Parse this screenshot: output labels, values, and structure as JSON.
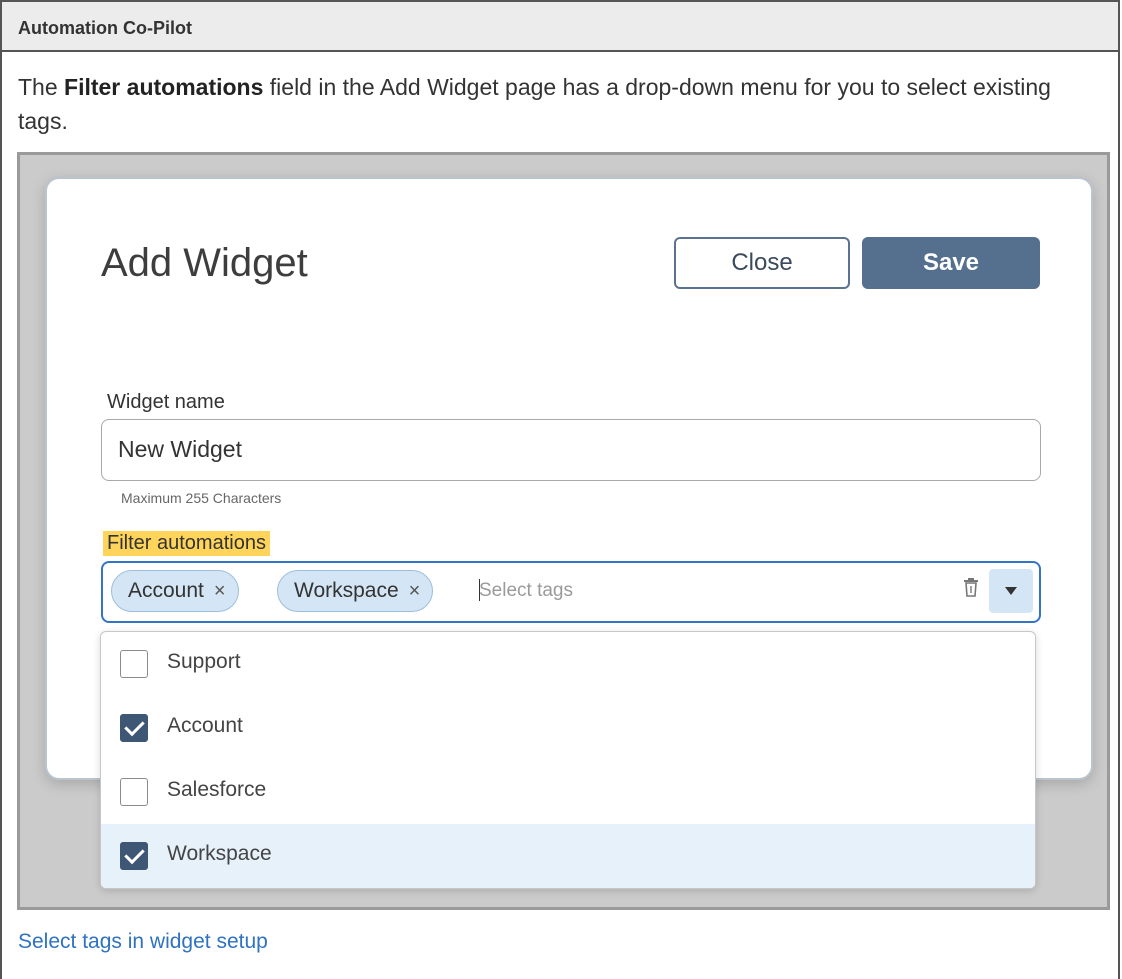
{
  "doc": {
    "header": "Automation Co-Pilot",
    "intro_before": "The ",
    "intro_bold": "Filter automations",
    "intro_after": " field in the Add Widget page has a drop-down menu for you to select existing tags.",
    "caption": "Select tags in widget setup"
  },
  "modal": {
    "title": "Add Widget",
    "close_label": "Close",
    "save_label": "Save",
    "widget_name_label": "Widget name",
    "widget_name_value": "New Widget",
    "widget_name_hint": "Maximum 255 Characters",
    "filter_label": "Filter automations",
    "selected_tags": [
      {
        "label": "Account",
        "remove": "×"
      },
      {
        "label": "Workspace",
        "remove": "×"
      }
    ],
    "tags_placeholder": "Select tags",
    "clear_icon": "trash-icon",
    "dropdown_icon": "caret-down-icon"
  },
  "menu": {
    "options": [
      {
        "label": "Support",
        "checked": false
      },
      {
        "label": "Account",
        "checked": true
      },
      {
        "label": "Salesforce",
        "checked": false
      },
      {
        "label": "Workspace",
        "checked": true,
        "highlighted": true
      }
    ]
  },
  "colors": {
    "primary": "#55708f",
    "focus_border": "#3574c4",
    "chip_bg": "#d4e6f5",
    "highlight": "#ffd45a",
    "link": "#2f72c1"
  }
}
